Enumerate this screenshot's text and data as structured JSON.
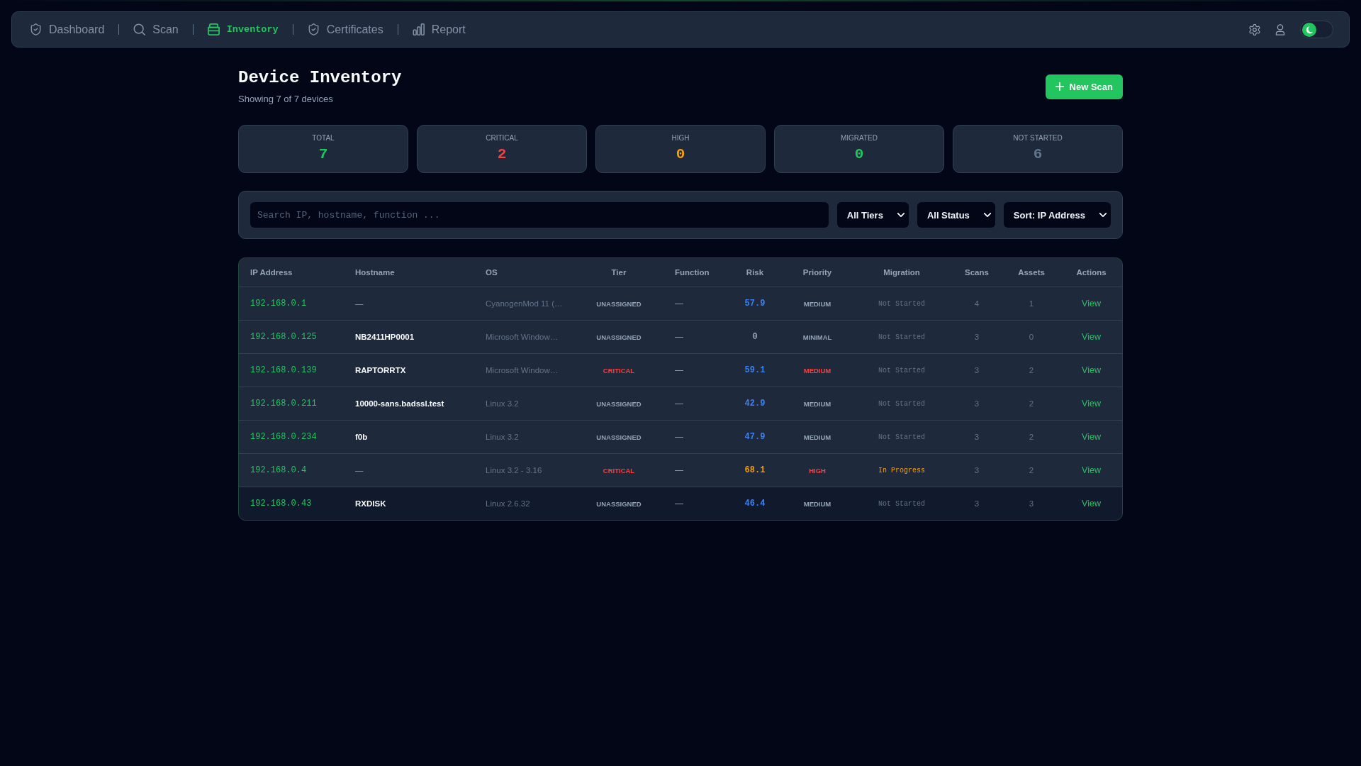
{
  "nav": {
    "tabs": [
      {
        "label": "Dashboard",
        "selected": false
      },
      {
        "label": "Scan",
        "selected": false
      },
      {
        "label": "Inventory",
        "selected": true
      },
      {
        "label": "Certificates",
        "selected": false
      },
      {
        "label": "Report",
        "selected": false
      }
    ],
    "theme_toggle": {
      "light_mode": false
    }
  },
  "header": {
    "title": "Device Inventory",
    "subtitle": "Showing 7 of 7 devices",
    "new_scan_button": "New Scan"
  },
  "stats": [
    {
      "label": "TOTAL",
      "value": "7",
      "color": "#22c55e"
    },
    {
      "label": "CRITICAL",
      "value": "2",
      "color": "#ef4444"
    },
    {
      "label": "HIGH",
      "value": "0",
      "color": "#f59e0b"
    },
    {
      "label": "MIGRATED",
      "value": "0",
      "color": "#22c55e"
    },
    {
      "label": "NOT STARTED",
      "value": "6",
      "color": "#64748b"
    }
  ],
  "filters": {
    "search": {
      "placeholder": "Search IP, hostname, function ..."
    },
    "selects": [
      "All Tiers",
      "All Status",
      "Sort: IP Address"
    ]
  },
  "table": {
    "columns": [
      "IP Address",
      "Hostname",
      "OS",
      "Tier",
      "Function",
      "Risk",
      "Priority",
      "Migration",
      "Scans",
      "Assets",
      "Actions"
    ],
    "rows": [
      {
        "ip": "192.168.0.1",
        "hostname": {
          "text": "—",
          "missing": true
        },
        "os": "CyanogenMod 11 (…",
        "tier": {
          "label": "UNASSIGNED",
          "color": "#94a3b8"
        },
        "function": "—",
        "risk": {
          "value": "57.9",
          "color": "#3b82f6"
        },
        "priority": {
          "label": "MEDIUM",
          "color": "#94a3b8"
        },
        "migration": {
          "label": "Not Started",
          "color": "#64748b"
        },
        "scans": "4",
        "assets": "1",
        "action": "View",
        "highlighted": false
      },
      {
        "ip": "192.168.0.125",
        "hostname": {
          "text": "NB2411HP0001",
          "missing": false
        },
        "os": "Microsoft Window…",
        "tier": {
          "label": "UNASSIGNED",
          "color": "#94a3b8"
        },
        "function": "—",
        "risk": {
          "value": "0",
          "color": "#94a3b8"
        },
        "priority": {
          "label": "MINIMAL",
          "color": "#94a3b8"
        },
        "migration": {
          "label": "Not Started",
          "color": "#64748b"
        },
        "scans": "3",
        "assets": "0",
        "action": "View",
        "highlighted": false
      },
      {
        "ip": "192.168.0.139",
        "hostname": {
          "text": "RAPTORRTX",
          "missing": false
        },
        "os": "Microsoft Window…",
        "tier": {
          "label": "CRITICAL",
          "color": "#ef4444"
        },
        "function": "—",
        "risk": {
          "value": "59.1",
          "color": "#3b82f6"
        },
        "priority": {
          "label": "MEDIUM",
          "color": "#ef4444"
        },
        "migration": {
          "label": "Not Started",
          "color": "#64748b"
        },
        "scans": "3",
        "assets": "2",
        "action": "View",
        "highlighted": false
      },
      {
        "ip": "192.168.0.211",
        "hostname": {
          "text": "10000-sans.badssl.test",
          "missing": false
        },
        "os": "Linux 3.2",
        "tier": {
          "label": "UNASSIGNED",
          "color": "#94a3b8"
        },
        "function": "—",
        "risk": {
          "value": "42.9",
          "color": "#3b82f6"
        },
        "priority": {
          "label": "MEDIUM",
          "color": "#94a3b8"
        },
        "migration": {
          "label": "Not Started",
          "color": "#64748b"
        },
        "scans": "3",
        "assets": "2",
        "action": "View",
        "highlighted": false
      },
      {
        "ip": "192.168.0.234",
        "hostname": {
          "text": "f0b",
          "missing": false
        },
        "os": "Linux 3.2",
        "tier": {
          "label": "UNASSIGNED",
          "color": "#94a3b8"
        },
        "function": "—",
        "risk": {
          "value": "47.9",
          "color": "#3b82f6"
        },
        "priority": {
          "label": "MEDIUM",
          "color": "#94a3b8"
        },
        "migration": {
          "label": "Not Started",
          "color": "#64748b"
        },
        "scans": "3",
        "assets": "2",
        "action": "View",
        "highlighted": false
      },
      {
        "ip": "192.168.0.4",
        "hostname": {
          "text": "—",
          "missing": true
        },
        "os": "Linux 3.2 - 3.16",
        "tier": {
          "label": "CRITICAL",
          "color": "#ef4444"
        },
        "function": "—",
        "risk": {
          "value": "68.1",
          "color": "#f59e0b"
        },
        "priority": {
          "label": "HIGH",
          "color": "#ef4444"
        },
        "migration": {
          "label": "In Progress",
          "color": "#f59e0b"
        },
        "scans": "3",
        "assets": "2",
        "action": "View",
        "highlighted": false
      },
      {
        "ip": "192.168.0.43",
        "hostname": {
          "text": "RXDISK",
          "missing": false
        },
        "os": "Linux 2.6.32",
        "tier": {
          "label": "UNASSIGNED",
          "color": "#94a3b8"
        },
        "function": "—",
        "risk": {
          "value": "46.4",
          "color": "#3b82f6"
        },
        "priority": {
          "label": "MEDIUM",
          "color": "#94a3b8"
        },
        "migration": {
          "label": "Not Started",
          "color": "#64748b"
        },
        "scans": "3",
        "assets": "3",
        "action": "View",
        "highlighted": true
      }
    ]
  }
}
